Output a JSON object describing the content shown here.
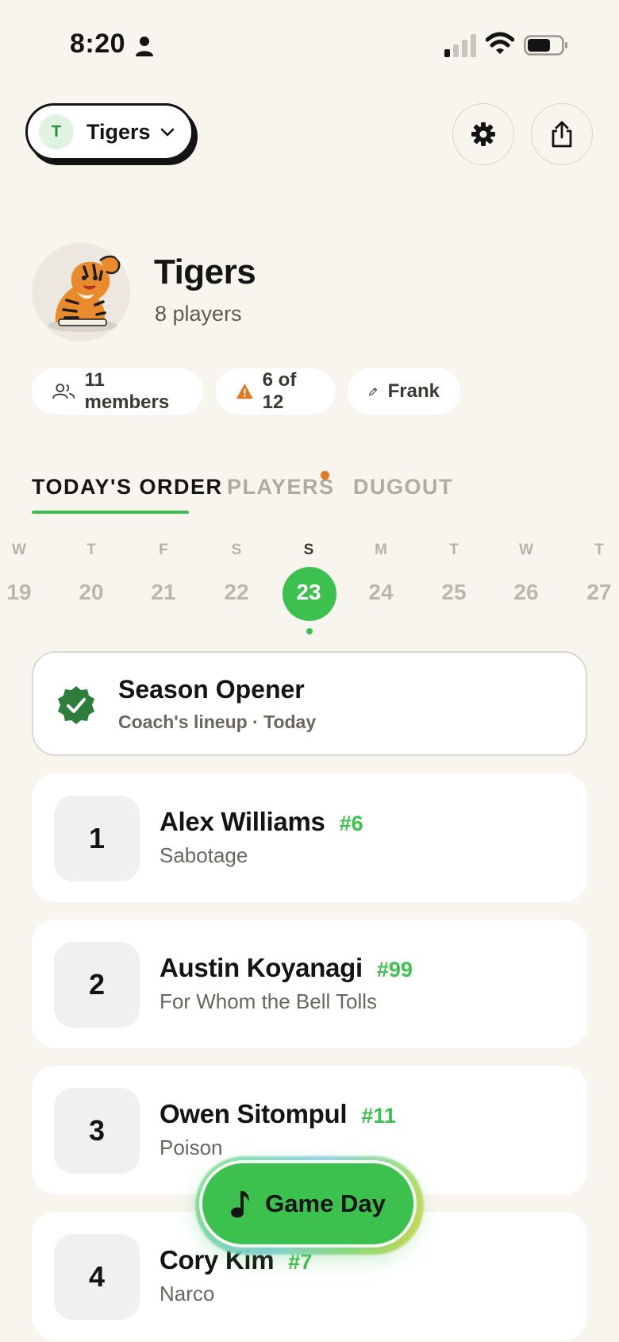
{
  "status_bar": {
    "time": "8:20",
    "icons": [
      "person-icon",
      "signal-icon",
      "wifi-icon",
      "battery-icon"
    ]
  },
  "header": {
    "team_initial": "T",
    "team_switch_label": "Tigers",
    "icons": [
      "chevron-down-icon",
      "gear-icon",
      "share-icon"
    ]
  },
  "team": {
    "name": "Tigers",
    "player_count": "8 players",
    "chips": {
      "members": "11 members",
      "count": "6 of 12",
      "coach": "Frank"
    }
  },
  "tabs": {
    "today": "TODAY'S ORDER",
    "players": "PLAYERS",
    "dugout": "DUGOUT"
  },
  "calendar": {
    "days": [
      {
        "letter": "W",
        "num": "19"
      },
      {
        "letter": "T",
        "num": "20"
      },
      {
        "letter": "F",
        "num": "21"
      },
      {
        "letter": "S",
        "num": "22"
      },
      {
        "letter": "S",
        "num": "23"
      },
      {
        "letter": "M",
        "num": "24"
      },
      {
        "letter": "T",
        "num": "25"
      },
      {
        "letter": "W",
        "num": "26"
      },
      {
        "letter": "T",
        "num": "27"
      }
    ],
    "selected": "23"
  },
  "season": {
    "title": "Season Opener",
    "subtitle": "Coach's lineup · Today"
  },
  "lineup": [
    {
      "order": "1",
      "name": "Alex Williams",
      "number": "#6",
      "song": "Sabotage"
    },
    {
      "order": "2",
      "name": "Austin Koyanagi",
      "number": "#99",
      "song": "For Whom the Bell Tolls"
    },
    {
      "order": "3",
      "name": "Owen Sitompul",
      "number": "#11",
      "song": "Poison"
    },
    {
      "order": "4",
      "name": "Cory Kim",
      "number": "#7",
      "song": "Narco"
    }
  ],
  "game_day": {
    "label": "Game Day"
  },
  "colors": {
    "accent": "#3cc14e",
    "background": "#f8f5ee",
    "notice": "#e07a21"
  }
}
